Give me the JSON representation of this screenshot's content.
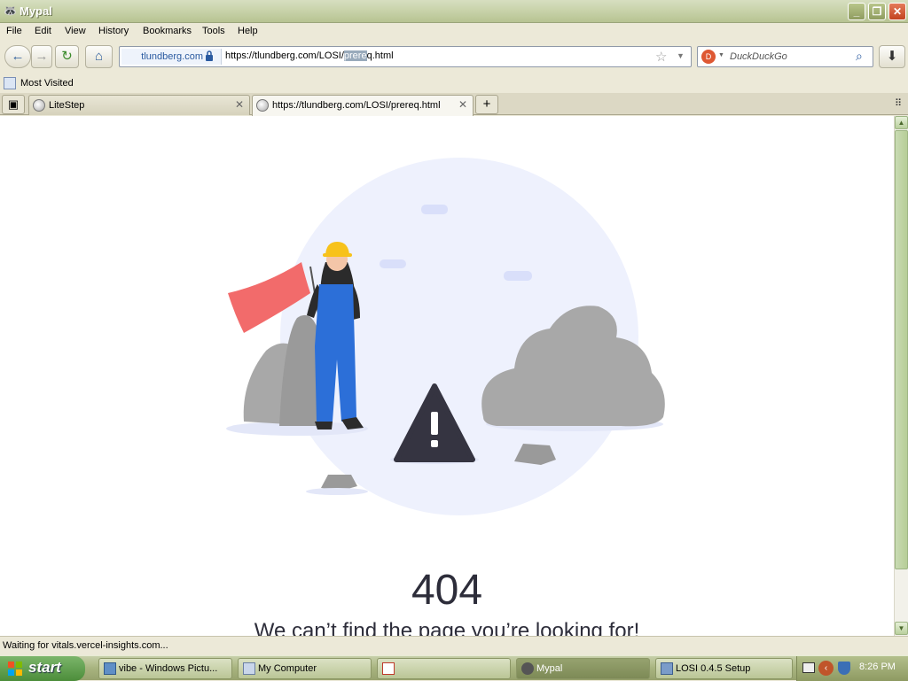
{
  "window": {
    "title": "Mypal"
  },
  "menu": [
    "File",
    "Edit",
    "View",
    "History",
    "Bookmarks",
    "Tools",
    "Help"
  ],
  "nav": {
    "site_identity": "tlundberg.com",
    "url_before": "https://tlundberg.com/LOSI/",
    "url_selected": "prere",
    "url_after": "q.html",
    "search_placeholder": "DuckDuckGo"
  },
  "bookmarks": {
    "most_visited": "Most Visited"
  },
  "tabs": [
    {
      "label": "LiteStep"
    },
    {
      "label": "https://tlundberg.com/LOSI/prereq.html"
    }
  ],
  "page": {
    "error_code": "404",
    "error_message": "We can’t find the page you’re looking for!"
  },
  "status": {
    "text": "Waiting for vitals.vercel-insights.com..."
  },
  "taskbar": {
    "start": "start",
    "tasks": [
      {
        "label": "vibe - Windows Pictu..."
      },
      {
        "label": "My Computer"
      },
      {
        "label": ""
      },
      {
        "label": "Mypal"
      },
      {
        "label": "LOSI 0.4.5 Setup"
      }
    ],
    "clock": "8:26 PM"
  },
  "colors": {
    "flag": "#f26b6b",
    "overalls": "#2c6fd8",
    "helmet": "#f7c21b",
    "warning": "#353441",
    "rock": "#a8a8a8",
    "backdrop": "#eef1fd"
  }
}
